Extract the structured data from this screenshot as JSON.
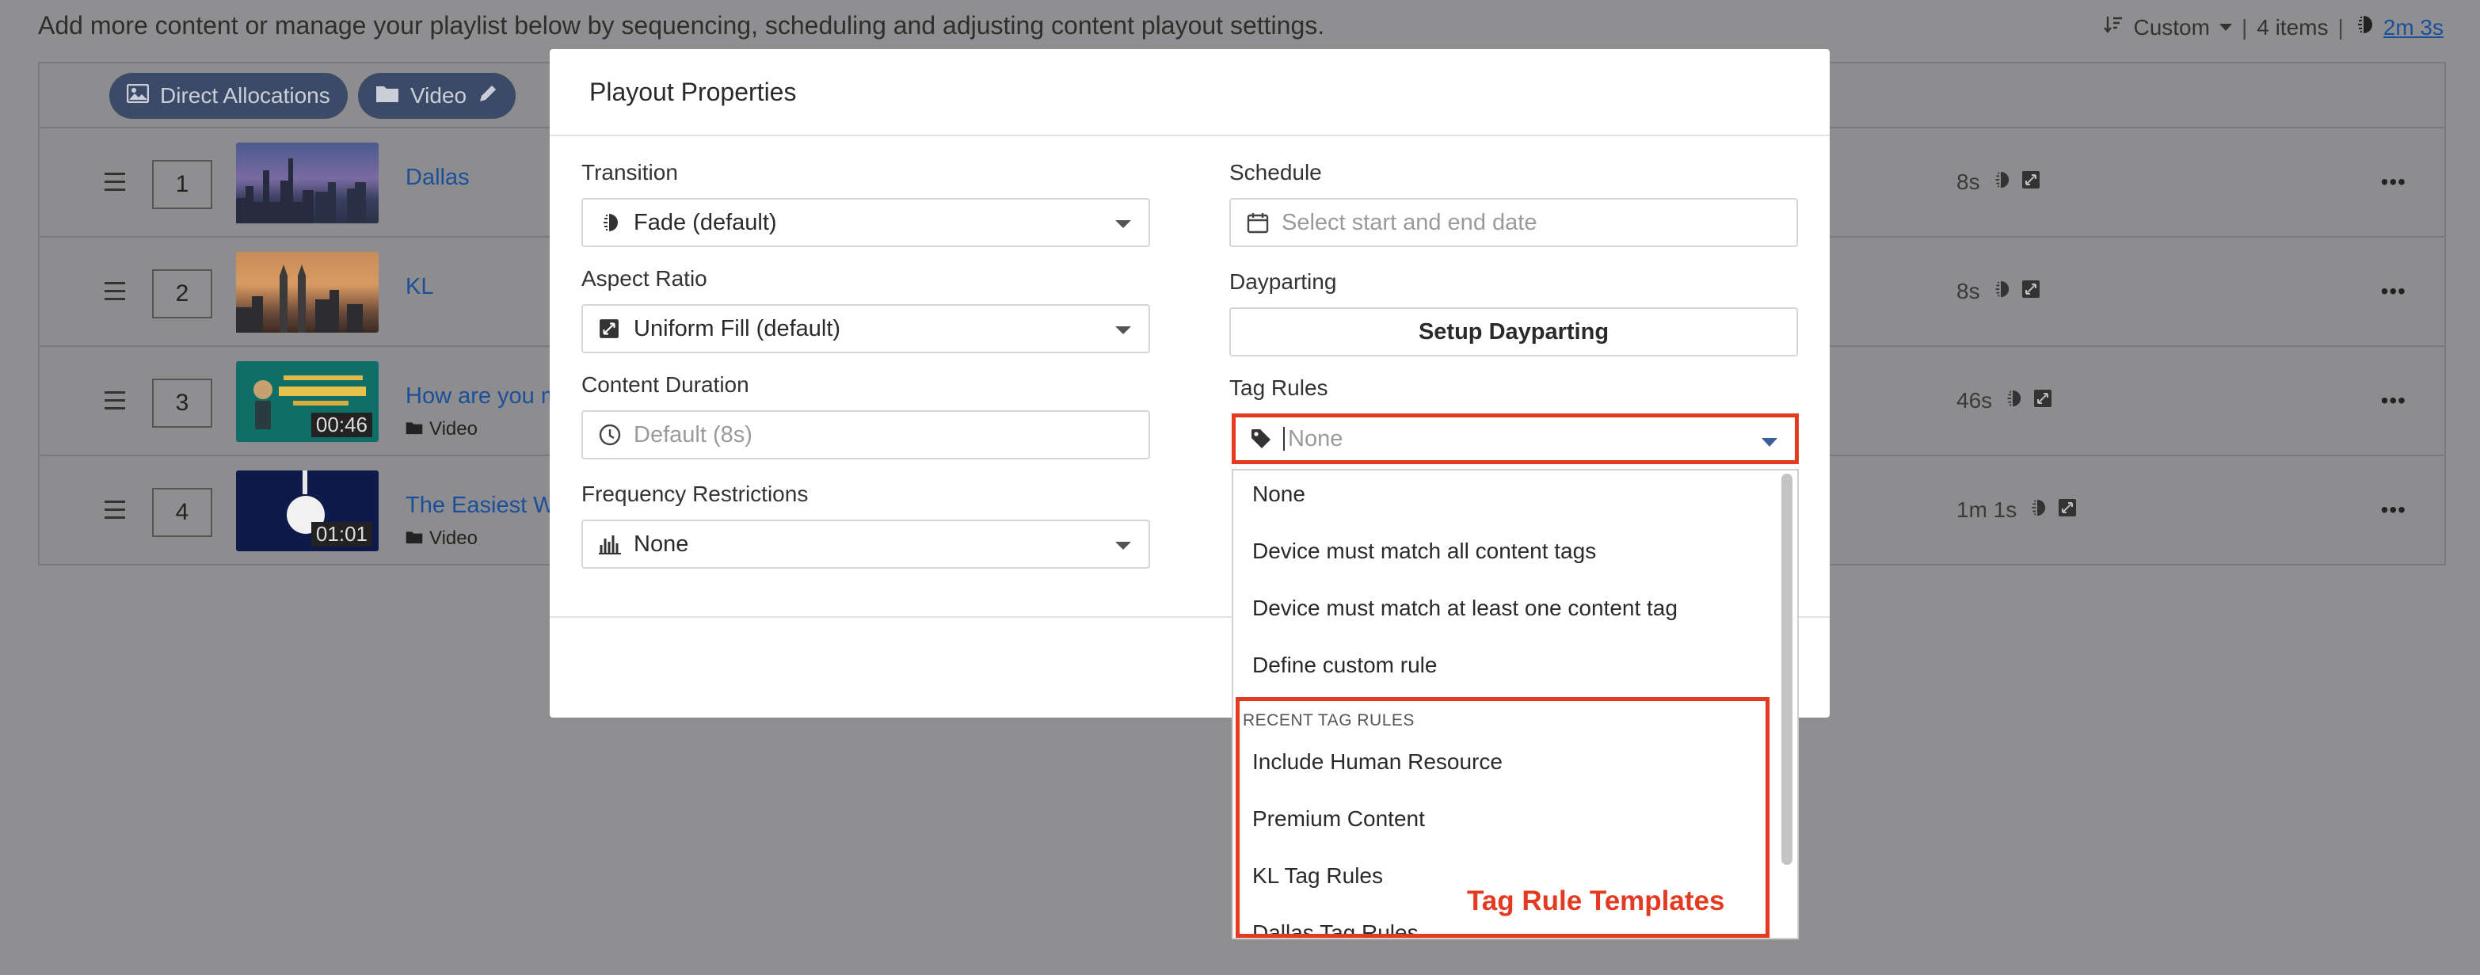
{
  "page": {
    "intro": "Add more content or manage your playlist below by sequencing, scheduling and adjusting content playout settings.",
    "sort_label": "Custom",
    "item_count": "4 items",
    "total_duration": "2m 3s"
  },
  "filters": [
    {
      "label": "Direct Allocations",
      "icon": "image-icon"
    },
    {
      "label": "Video",
      "icon": "folder-icon"
    }
  ],
  "rows": [
    {
      "index": "1",
      "title": "Dallas",
      "subtitle": "",
      "thumb_time": "",
      "duration": "8s"
    },
    {
      "index": "2",
      "title": "KL",
      "subtitle": "",
      "thumb_time": "",
      "duration": "8s"
    },
    {
      "index": "3",
      "title": "How are you m",
      "subtitle": "Video",
      "thumb_time": "00:46",
      "duration": "46s"
    },
    {
      "index": "4",
      "title": "The Easiest Wa",
      "subtitle": "Video",
      "thumb_time": "01:01",
      "duration": "1m 1s"
    }
  ],
  "modal": {
    "title": "Playout Properties",
    "transition": {
      "label": "Transition",
      "value": "Fade (default)"
    },
    "aspect_ratio": {
      "label": "Aspect Ratio",
      "value": "Uniform Fill (default)"
    },
    "content_duration": {
      "label": "Content Duration",
      "placeholder": "Default (8s)"
    },
    "frequency": {
      "label": "Frequency Restrictions",
      "value": "None"
    },
    "schedule": {
      "label": "Schedule",
      "placeholder": "Select start and end date"
    },
    "dayparting": {
      "label": "Dayparting",
      "button": "Setup Dayparting"
    },
    "tag_rules": {
      "label": "Tag Rules",
      "placeholder": "None"
    }
  },
  "dropdown": {
    "options": [
      "None",
      "Device must match all content tags",
      "Device must match at least one content tag",
      "Define custom rule"
    ],
    "group_header": "RECENT TAG RULES",
    "recent": [
      "Include Human Resource",
      "Premium Content",
      "KL Tag Rules",
      "Dallas Tag Rules"
    ]
  },
  "annotation": "Tag Rule Templates",
  "colors": {
    "accent_red": "#e23b22",
    "link_blue": "#1c4f9a",
    "chip_bg": "#3b4a66"
  }
}
